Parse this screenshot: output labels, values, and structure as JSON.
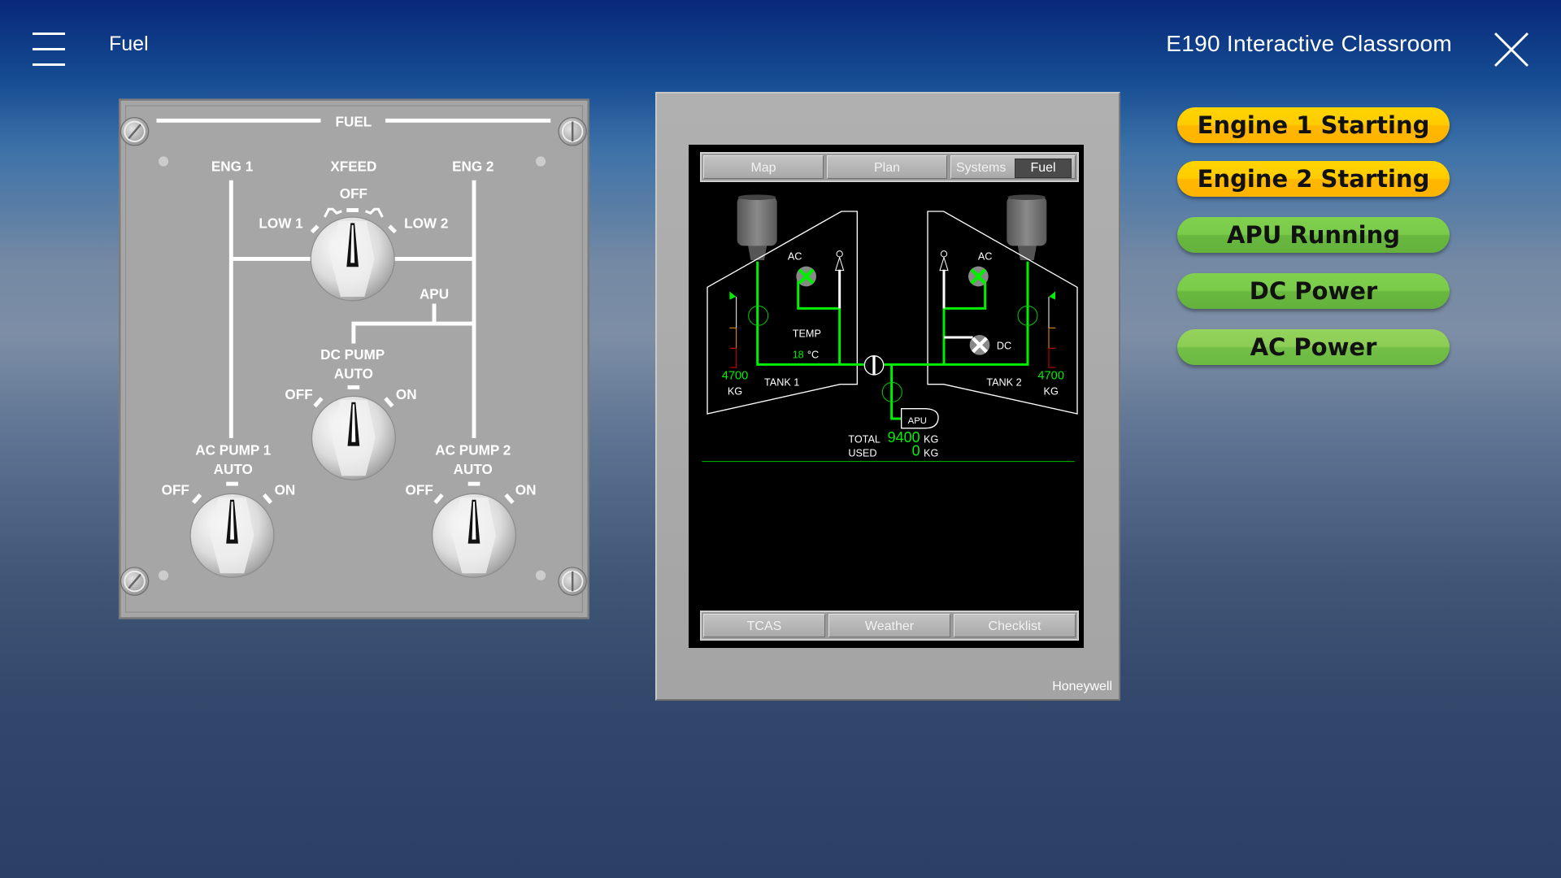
{
  "header": {
    "menu_icon": "hamburger-icon",
    "page_title": "Fuel",
    "app_title": "E190 Interactive Classroom",
    "close_icon": "close-icon"
  },
  "fuel_panel": {
    "title": "FUEL",
    "eng1": "ENG 1",
    "xfeed": "XFEED",
    "eng2": "ENG 2",
    "xfeed_off": "OFF",
    "low1": "LOW 1",
    "low2": "LOW 2",
    "apu": "APU",
    "dc_pump": {
      "label": "DC PUMP",
      "auto": "AUTO",
      "off": "OFF",
      "on": "ON",
      "position": "AUTO"
    },
    "ac_pump_1": {
      "label": "AC PUMP 1",
      "auto": "AUTO",
      "off": "OFF",
      "on": "ON",
      "position": "AUTO"
    },
    "ac_pump_2": {
      "label": "AC PUMP 2",
      "auto": "AUTO",
      "off": "OFF",
      "on": "ON",
      "position": "AUTO"
    },
    "xfeed_position": "OFF"
  },
  "mfd": {
    "top_tabs": [
      "Map",
      "Plan",
      "Systems"
    ],
    "active_subtab": "Fuel",
    "bottom_tabs": [
      "TCAS",
      "Weather",
      "Checklist"
    ],
    "brand": "Honeywell",
    "synoptic": {
      "ac_left": "AC",
      "ac_right": "AC",
      "dc": "DC",
      "temp_label": "TEMP",
      "temp_value": "18",
      "temp_unit": "°C",
      "tank1_label": "TANK 1",
      "tank2_label": "TANK 2",
      "tank1_qty": "4700",
      "tank2_qty": "4700",
      "unit": "KG",
      "apu": "APU",
      "total_label": "TOTAL",
      "total_value": "9400",
      "used_label": "USED",
      "used_value": "0",
      "colors": {
        "flow": "#00ee00",
        "line": "#ffffff",
        "caution": "#f0a000",
        "warning": "#e00000"
      }
    }
  },
  "status_buttons": [
    {
      "label": "Engine 1 Starting",
      "color": "#ffc800"
    },
    {
      "label": "Engine 2 Starting",
      "color": "#ffc800"
    },
    {
      "label": "APU Running",
      "color": "#72c244"
    },
    {
      "label": "DC Power",
      "color": "#72c244"
    },
    {
      "label": "AC Power",
      "color": "#84c950"
    }
  ]
}
